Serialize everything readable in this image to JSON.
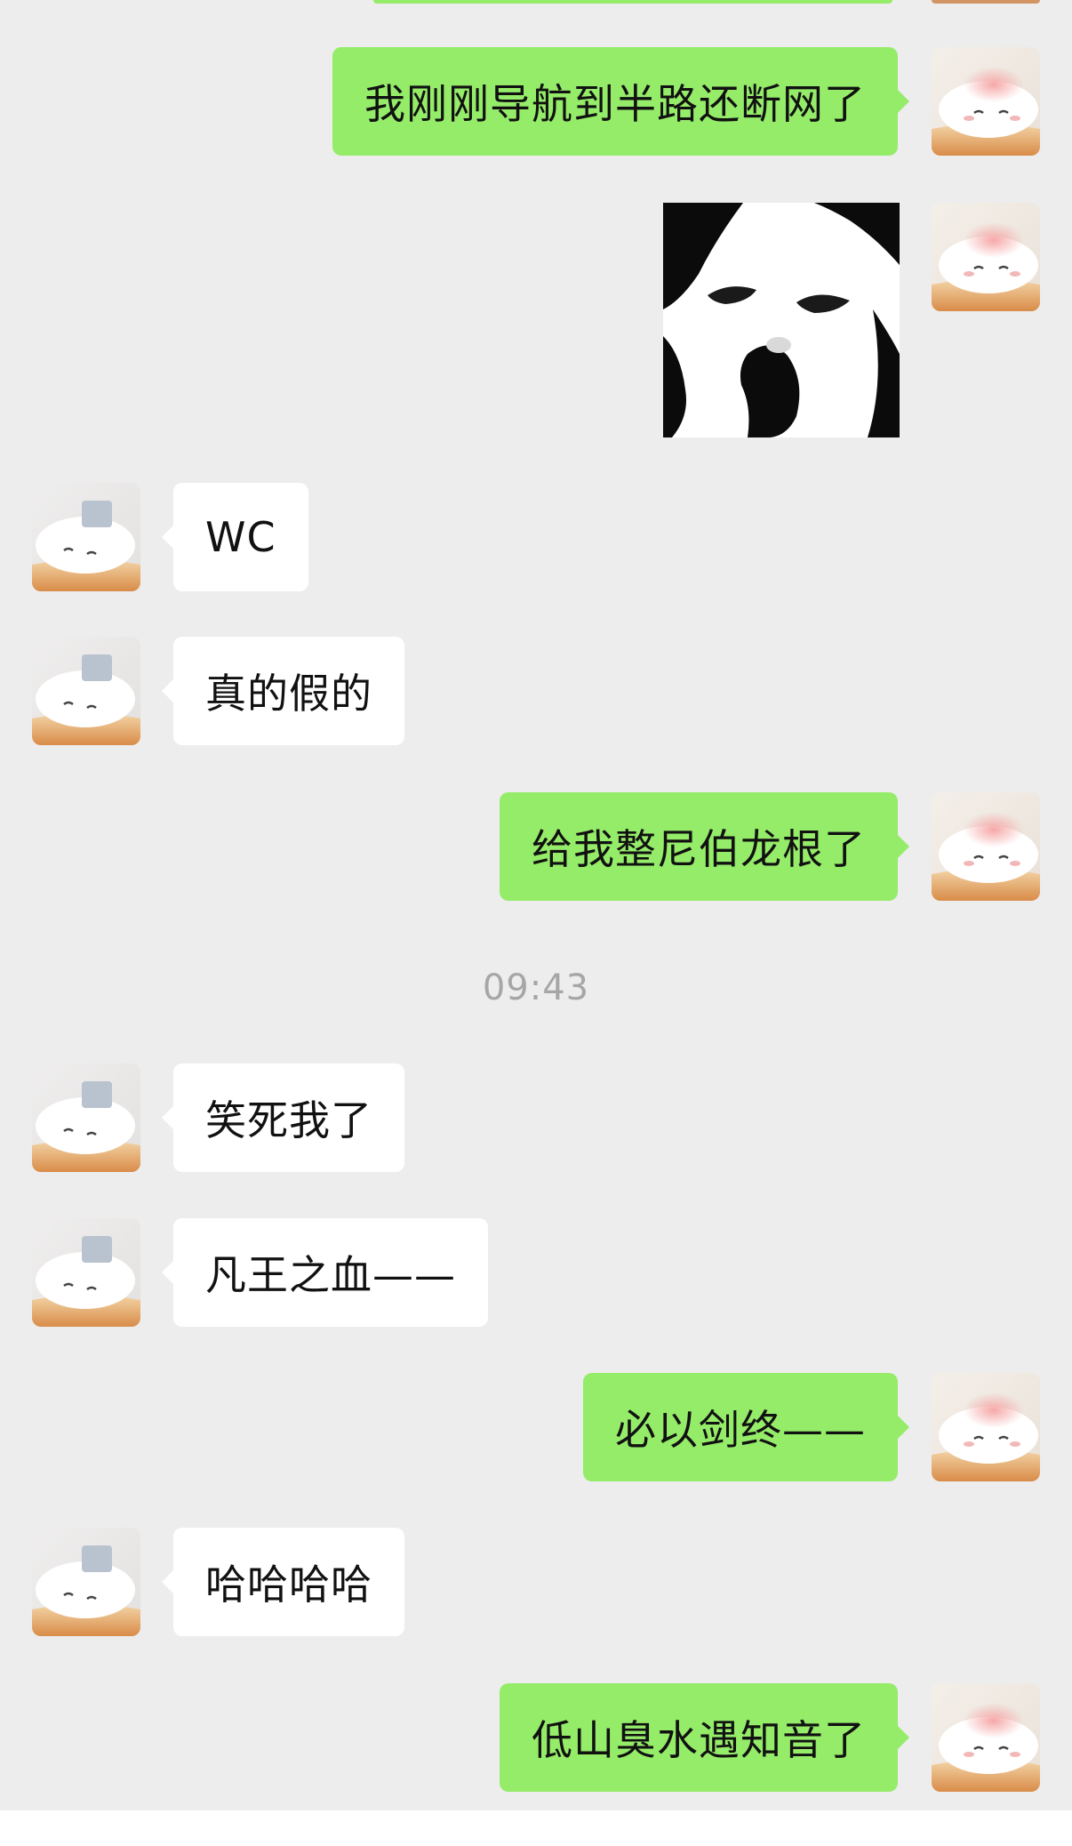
{
  "timestamp": "09:43",
  "colors": {
    "background": "#ededed",
    "outgoing_bubble": "#95ec69",
    "incoming_bubble": "#ffffff",
    "timestamp_text": "#a6a6a6"
  },
  "messages": [
    {
      "direction": "out",
      "type": "text",
      "text": "我刚刚导航到半路还断网了"
    },
    {
      "direction": "out",
      "type": "sticker",
      "icon": "panda-meme-sticker"
    },
    {
      "direction": "in",
      "type": "text",
      "text": "WC"
    },
    {
      "direction": "in",
      "type": "text",
      "text": "真的假的"
    },
    {
      "direction": "out",
      "type": "text",
      "text": "给我整尼伯龙根了"
    },
    {
      "direction": "in",
      "type": "text",
      "text": "笑死我了"
    },
    {
      "direction": "in",
      "type": "text",
      "text": "凡王之血——"
    },
    {
      "direction": "out",
      "type": "text",
      "text": "必以剑终——"
    },
    {
      "direction": "in",
      "type": "text",
      "text": "哈哈哈哈"
    },
    {
      "direction": "out",
      "type": "text",
      "text": "低山臭水遇知音了"
    }
  ]
}
